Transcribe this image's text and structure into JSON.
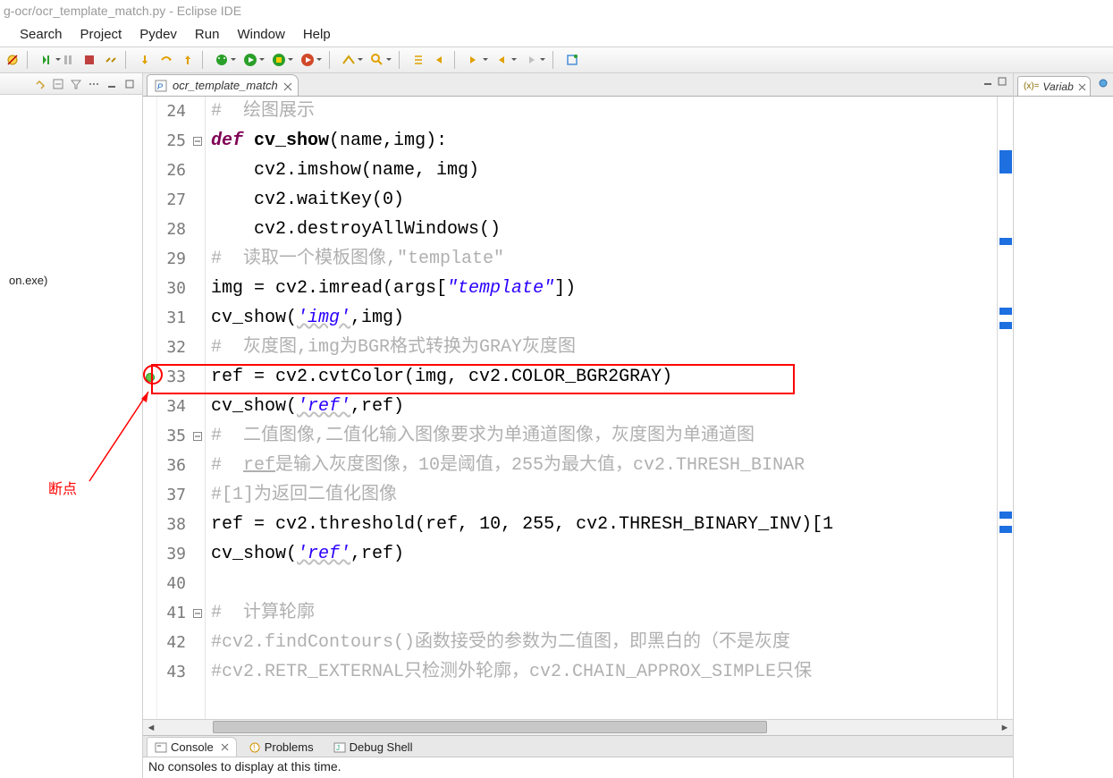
{
  "title": "g-ocr/ocr_template_match.py - Eclipse IDE",
  "menu": [
    "Search",
    "Project",
    "Pydev",
    "Run",
    "Window",
    "Help"
  ],
  "left": {
    "body_text": "on.exe)"
  },
  "editor": {
    "tab_label": "ocr_template_match",
    "lines": [
      {
        "n": 24,
        "type": "comment",
        "text": "#  绘图展示"
      },
      {
        "n": 25,
        "type": "def",
        "fold": true
      },
      {
        "n": 26,
        "type": "body",
        "text": "cv2.imshow(name, img)"
      },
      {
        "n": 27,
        "type": "body",
        "text": "cv2.waitKey(0)"
      },
      {
        "n": 28,
        "type": "body",
        "text": "cv2.destroyAllWindows()"
      },
      {
        "n": 29,
        "type": "comment",
        "text": "#  读取一个模板图像,\"template\""
      },
      {
        "n": 30,
        "type": "code30"
      },
      {
        "n": 31,
        "type": "code31"
      },
      {
        "n": 32,
        "type": "comment",
        "text": "#  灰度图,img为BGR格式转换为GRAY灰度图"
      },
      {
        "n": 33,
        "type": "code33",
        "breakpoint": true
      },
      {
        "n": 34,
        "type": "code34"
      },
      {
        "n": 35,
        "type": "comment",
        "fold": true,
        "text": "#  二值图像,二值化输入图像要求为单通道图像，灰度图为单通道图"
      },
      {
        "n": 36,
        "type": "comment",
        "text": "#  ref是输入灰度图像，10是阈值，255为最大值，cv2.THRESH_BINAR"
      },
      {
        "n": 37,
        "type": "comment",
        "text": "#[1]为返回二值化图像"
      },
      {
        "n": 38,
        "type": "code38"
      },
      {
        "n": 39,
        "type": "code39"
      },
      {
        "n": 40,
        "type": "blank"
      },
      {
        "n": 41,
        "type": "comment",
        "fold": true,
        "text": "#  计算轮廓"
      },
      {
        "n": 42,
        "type": "comment",
        "text": "#cv2.findContours()函数接受的参数为二值图，即黑白的（不是灰度"
      },
      {
        "n": 43,
        "type": "comment",
        "text": "#cv2.RETR_EXTERNAL只检测外轮廓，cv2.CHAIN_APPROX_SIMPLE只保"
      }
    ],
    "def_kw": "def",
    "def_name": "cv_show",
    "def_params": "(name,img):",
    "l30_pre": "img = cv2.imread(args[",
    "l30_str": "\"template\"",
    "l30_post": "])",
    "l31_pre": "cv_show(",
    "l31_str": "'img'",
    "l31_post": ",img)",
    "l33": "ref = cv2.cvtColor(img, cv2.COLOR_BGR2GRAY)",
    "l34_pre": "cv_show(",
    "l34_str": "'ref'",
    "l34_post": ",ref)",
    "l38_a": "ref = cv2.threshold(ref, ",
    "l38_b": "10",
    "l38_c": ", ",
    "l38_d": "255",
    "l38_e": ", cv2.THRESH_BINARY_INV)[1",
    "l39_pre": "cv_show(",
    "l39_str": "'ref'",
    "l39_post": ",ref)"
  },
  "right": {
    "tab_label": "Variab"
  },
  "console": {
    "tabs": [
      "Console",
      "Problems",
      "Debug Shell"
    ],
    "body": "No consoles to display at this time."
  },
  "annotation": {
    "label": "断点"
  }
}
